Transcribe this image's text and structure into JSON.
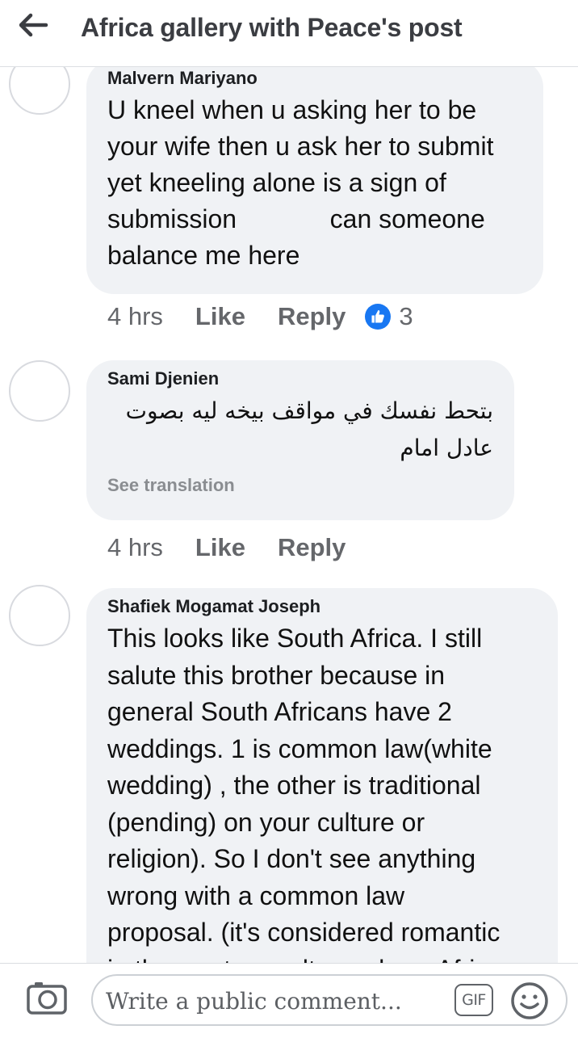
{
  "header": {
    "title": "Africa gallery with Peace's post",
    "back_icon": "arrow-left-icon"
  },
  "colors": {
    "bubble": "#f0f2f5",
    "like_blue": "#1877f2",
    "muted": "#65676b"
  },
  "comments": [
    {
      "author": "Malvern Mariyano",
      "text": "U kneel when u asking her to be\nyour wife then u ask her to submit\nyet kneeling alone is a sign of\nsubmission             can someone\nbalance me here",
      "time": "4 hrs",
      "like_label": "Like",
      "reply_label": "Reply",
      "reactions": "3"
    },
    {
      "author": "Sami Djenien",
      "text": "بتحط نفسك في مواقف بيخه ليه بصوت\nعادل امام",
      "see_translation": "See translation",
      "time": "4 hrs",
      "like_label": "Like",
      "reply_label": "Reply"
    },
    {
      "author": "Shafiek Mogamat Joseph",
      "text": "This looks like South Africa. I still\nsalute this brother because in\ngeneral South Africans have 2\nweddings. 1 is common law(white\nwedding) , the other is traditional\n(pending) on your culture or\nreligion). So I don't see anything\nwrong with a common law\nproposal. (it's considered romantic\nin the western culture where Africa"
    }
  ],
  "composer": {
    "placeholder": "Write a public comment...",
    "gif_label": "GIF",
    "camera_icon": "camera-icon",
    "emoji_icon": "smiley-icon"
  }
}
